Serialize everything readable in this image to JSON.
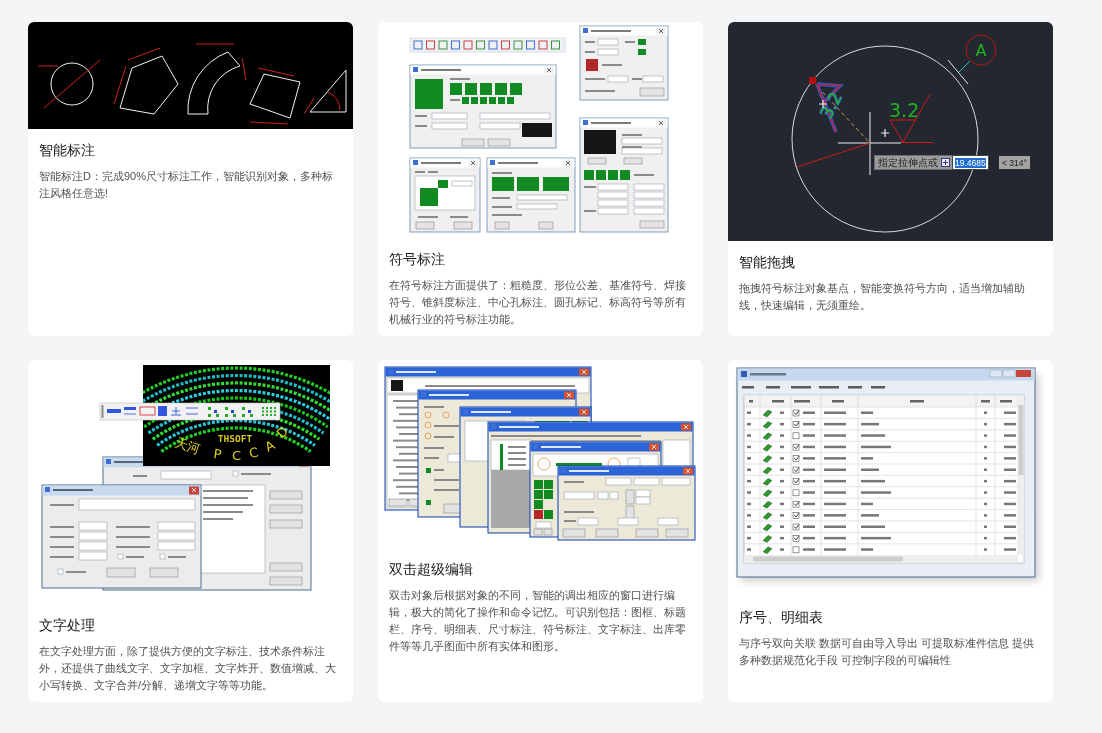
{
  "features": [
    {
      "title": "智能标注",
      "description": "智能标注D：完成90%尺寸标注工作，智能识别对象，多种标注风格任意选!",
      "image": {
        "kind": "dimensions"
      }
    },
    {
      "title": "符号标注",
      "description": "在符号标注方面提供了：粗糙度、形位公差、基准符号、焊接符号、锥斜度标注、中心孔标注、圆孔标记、标高符号等所有机械行业的符号标注功能。",
      "image": {
        "kind": "symbol-dialogs"
      }
    },
    {
      "title": "智能拖拽",
      "description": "拖拽符号标注对象基点，智能变换符号方向，适当增加辅助线，快速编辑，无须重绘。",
      "image": {
        "kind": "drag-edit",
        "datum_letter": "A",
        "roughness_value": "3.2",
        "rotated_roughness_value": "3.2",
        "prompt": "指定拉伸点或",
        "length": "19.4685",
        "angle": "< 314°"
      }
    },
    {
      "title": "文字处理",
      "description": "在文字处理方面，除了提供方便的文字标注、技术条件标注外，还提供了曲线文字、文字加框、文字炸开、数值增减、大小写转换、文字合并/分解、递增文字等等功能。",
      "image": {
        "kind": "text-tools",
        "brand": "THSOFT",
        "arc_text_parts": [
          "天河",
          "P",
          "C",
          "C",
          "A",
          "D"
        ]
      }
    },
    {
      "title": "双击超级编辑",
      "description": "双击对象后根据对象的不同，智能的调出相应的窗口进行编辑，极大的简化了操作和命令记忆。可识别包括：图框、标题栏、序号、明细表、尺寸标注、符号标注、文字标注、出库零件等等几乎图面中所有实体和图形。",
      "image": {
        "kind": "dialog-stack"
      }
    },
    {
      "title": "序号、明细表",
      "description": "与序号双向关联 数据可自由导入导出 可提取标准件信息 提供多种数据规范化手段 可控制字段的可编辑性",
      "image": {
        "kind": "parts-table"
      }
    }
  ]
}
